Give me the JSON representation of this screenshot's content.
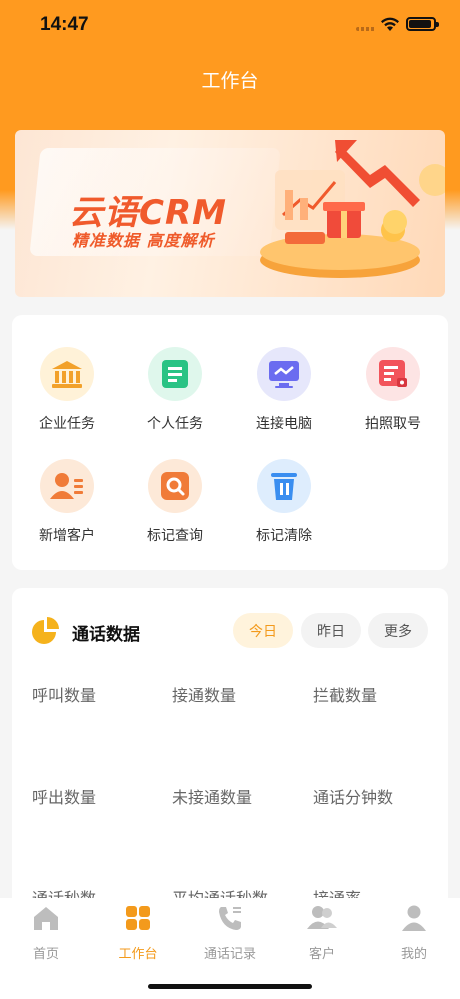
{
  "status": {
    "time": "14:47"
  },
  "nav": {
    "title": "工作台"
  },
  "banner": {
    "title": "云语CRM",
    "subtitle": "精准数据   高度解析"
  },
  "tools": [
    {
      "label": "企业任务",
      "icon": "bank-icon",
      "color": "#f5a623"
    },
    {
      "label": "个人任务",
      "icon": "task-list-icon",
      "color": "#2ec98a"
    },
    {
      "label": "连接电脑",
      "icon": "monitor-icon",
      "color": "#6c6ff0"
    },
    {
      "label": "拍照取号",
      "icon": "photo-number-icon",
      "color": "#f4535a"
    },
    {
      "label": "新增客户",
      "icon": "add-customer-icon",
      "color": "#f2813a"
    },
    {
      "label": "标记查询",
      "icon": "search-icon",
      "color": "#f2813a"
    },
    {
      "label": "标记清除",
      "icon": "trash-icon",
      "color": "#3a8ef0"
    }
  ],
  "call_data": {
    "title": "通话数据",
    "filters": [
      "今日",
      "昨日",
      "更多"
    ],
    "active_filter": "今日",
    "metrics": [
      "呼叫数量",
      "接通数量",
      "拦截数量",
      "呼出数量",
      "未接通数量",
      "通话分钟数",
      "通话秒数",
      "平均通话秒数",
      "接通率"
    ]
  },
  "tabbar": {
    "items": [
      "首页",
      "工作台",
      "通话记录",
      "客户",
      "我的"
    ],
    "active": "工作台"
  },
  "colors": {
    "brand": "#ff9a1f",
    "accent": "#f39a1c"
  }
}
